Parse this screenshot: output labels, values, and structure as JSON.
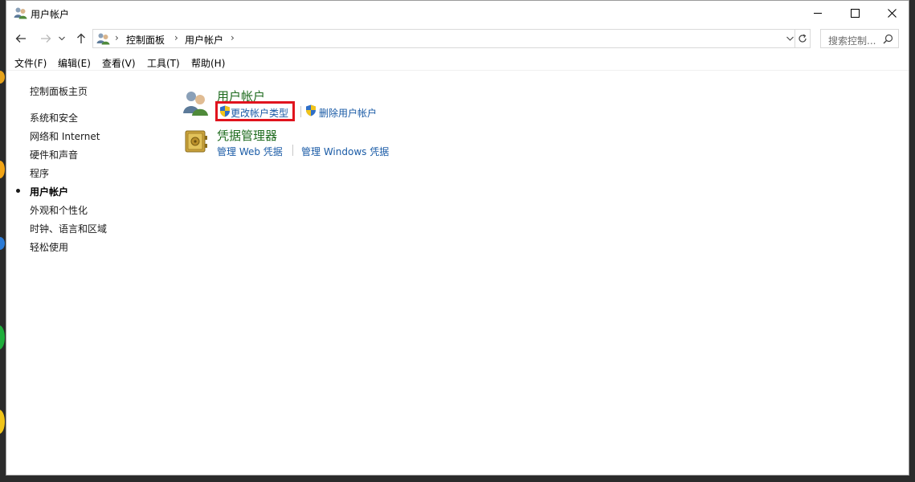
{
  "window": {
    "title": "用户帐户"
  },
  "address": {
    "crumbs": [
      "控制面板",
      "用户帐户"
    ],
    "search_placeholder": "搜索控制..."
  },
  "menu": {
    "items": [
      "文件(F)",
      "编辑(E)",
      "查看(V)",
      "工具(T)",
      "帮助(H)"
    ]
  },
  "leftnav": {
    "home": "控制面板主页",
    "items": [
      "系统和安全",
      "网络和 Internet",
      "硬件和声音",
      "程序",
      "用户帐户",
      "外观和个性化",
      "时钟、语言和区域",
      "轻松使用"
    ],
    "active_index": 4
  },
  "main": {
    "categories": [
      {
        "title": "用户帐户",
        "links": [
          "更改帐户类型",
          "删除用户帐户"
        ]
      },
      {
        "title": "凭据管理器",
        "links": [
          "管理 Web 凭据",
          "管理 Windows 凭据"
        ]
      }
    ]
  },
  "colors": {
    "category_title": "#1e6b1e",
    "link": "#1a5ba6",
    "highlight": "#e0141e"
  }
}
